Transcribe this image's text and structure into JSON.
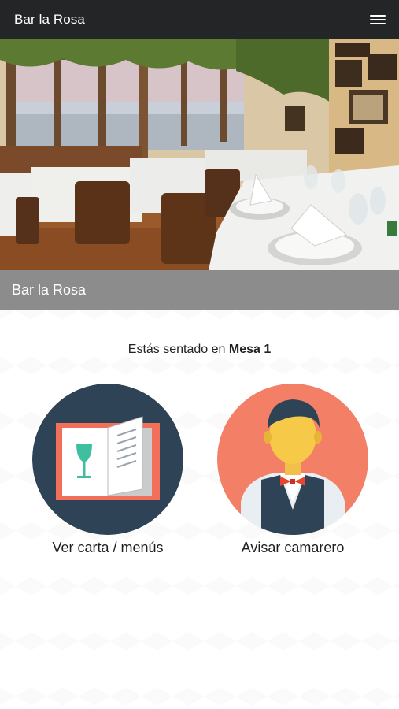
{
  "header": {
    "title": "Bar la Rosa",
    "menu_icon": "hamburger-icon"
  },
  "hero": {
    "image": "restaurant-interior-photo",
    "caption": "Bar la Rosa"
  },
  "seat": {
    "prefix": "Estás sentado en",
    "table": "Mesa 1"
  },
  "actions": [
    {
      "label": "Ver carta / menús",
      "icon": "menu-book-icon",
      "color": "#2e4356"
    },
    {
      "label": "Avisar camarero",
      "icon": "waiter-icon",
      "color": "#f47f67"
    }
  ],
  "colors": {
    "topbar": "#232527",
    "caption_bar": "#8c8c8c",
    "accent_salmon": "#f47f67",
    "navy": "#2e4356"
  }
}
